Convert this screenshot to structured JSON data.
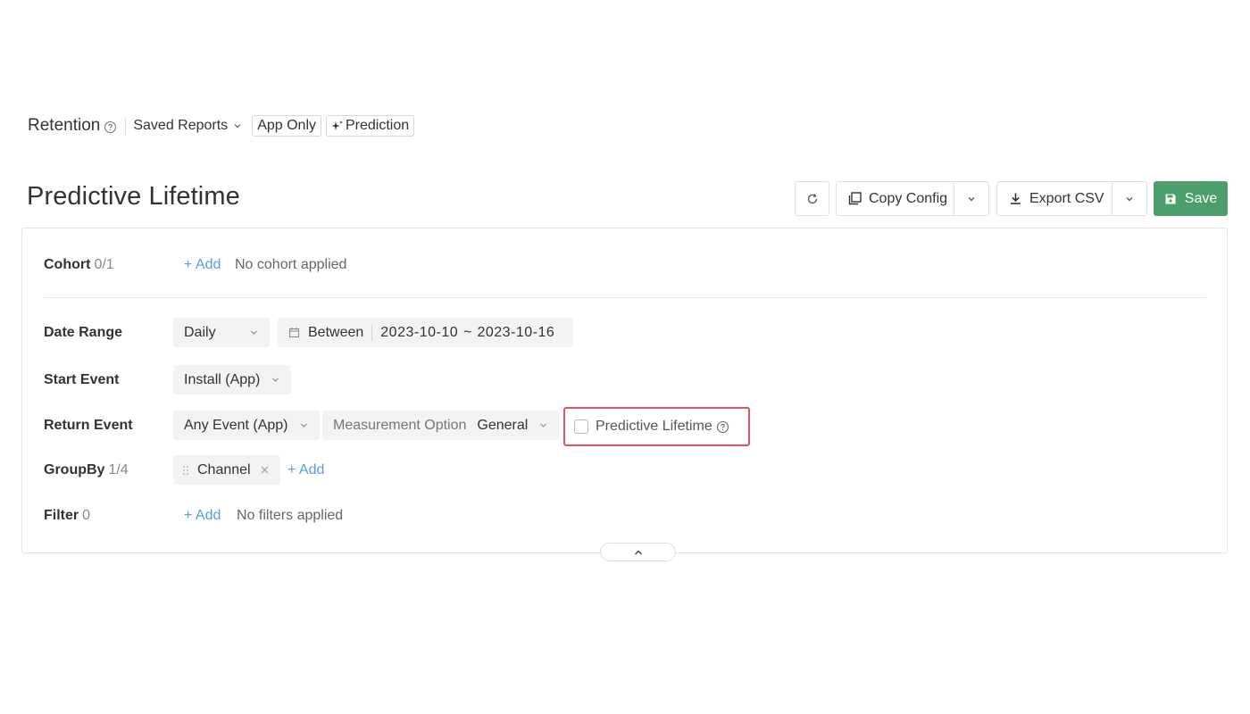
{
  "header": {
    "section_title": "Retention",
    "saved_reports_label": "Saved Reports",
    "tags": [
      "App Only",
      "Prediction"
    ]
  },
  "page_title": "Predictive Lifetime",
  "toolbar": {
    "copy_config_label": "Copy Config",
    "export_csv_label": "Export CSV",
    "save_label": "Save",
    "save_color": "#4c9f6c"
  },
  "cohort": {
    "label": "Cohort",
    "count": "0/1",
    "add_label": "+ Add",
    "empty_text": "No cohort applied"
  },
  "date_range": {
    "label": "Date Range",
    "granularity": "Daily",
    "mode": "Between",
    "start": "2023-10-10",
    "separator": "~",
    "end": "2023-10-16"
  },
  "start_event": {
    "label": "Start Event",
    "value": "Install (App)"
  },
  "return_event": {
    "label": "Return Event",
    "value": "Any Event (App)",
    "measurement_label": "Measurement Option",
    "measurement_value": "General",
    "predictive_label": "Predictive Lifetime",
    "predictive_checked": false,
    "highlight_color": "#e05555"
  },
  "group_by": {
    "label": "GroupBy",
    "count": "1/4",
    "chip": "Channel",
    "add_label": "+ Add"
  },
  "filter": {
    "label": "Filter",
    "count": "0",
    "add_label": "+ Add",
    "empty_text": "No filters applied"
  },
  "accent_link_color": "#5b9be6"
}
